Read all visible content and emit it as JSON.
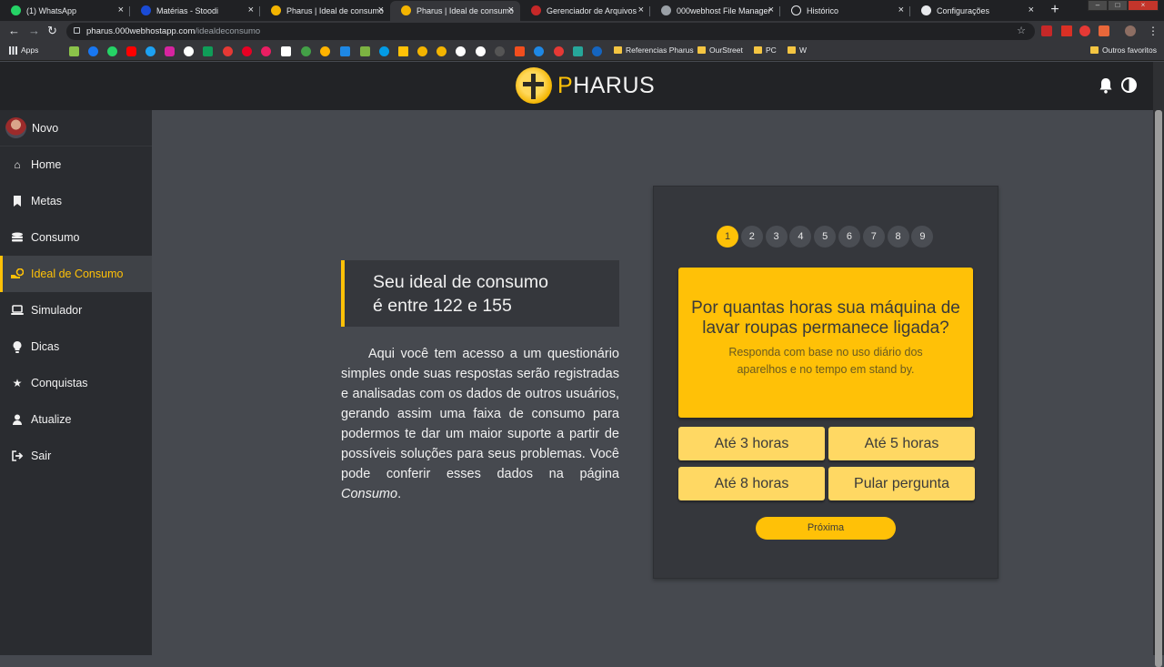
{
  "browser": {
    "tabs": [
      {
        "title": "(1) WhatsApp",
        "color": "#25d366"
      },
      {
        "title": "Matérias - Stoodi",
        "color": "#1a4bd6"
      },
      {
        "title": "Pharus | Ideal de consumo",
        "color": "#f3b400"
      },
      {
        "title": "Pharus | Ideal de consumo",
        "color": "#f3b400",
        "active": true
      },
      {
        "title": "Gerenciador de Arquivos",
        "color": "#c62828"
      },
      {
        "title": "000webhost File Manager",
        "color": "#9aa0a6"
      },
      {
        "title": "Histórico",
        "color": "#e8eaed"
      },
      {
        "title": "Configurações",
        "color": "#e8eaed"
      }
    ],
    "url_host": "pharus.000webhostapp.com",
    "url_path": "/idealdeconsumo",
    "bookmarks": {
      "apps": "Apps",
      "folders": [
        "Referencias Pharus",
        "OurStreet",
        "PC",
        "W"
      ],
      "others": "Outros favoritos"
    }
  },
  "header": {
    "logo_initial": "P",
    "logo_rest": "HARUS"
  },
  "sidebar": {
    "user": "Novo",
    "items": [
      {
        "label": "Home",
        "icon": "home-icon"
      },
      {
        "label": "Metas",
        "icon": "bookmark-icon"
      },
      {
        "label": "Consumo",
        "icon": "coins-icon"
      },
      {
        "label": "Ideal de Consumo",
        "icon": "hand-coins-icon",
        "active": true
      },
      {
        "label": "Simulador",
        "icon": "laptop-icon"
      },
      {
        "label": "Dicas",
        "icon": "lightbulb-icon"
      },
      {
        "label": "Conquistas",
        "icon": "star-icon"
      },
      {
        "label": "Atualize",
        "icon": "user-edit-icon"
      },
      {
        "label": "Sair",
        "icon": "sign-out-icon"
      }
    ]
  },
  "main": {
    "range_line1": "Seu ideal de consumo",
    "range_line2": "é entre 122 e 155",
    "description": "Aqui você tem acesso a um questionário simples onde suas respostas serão registradas e analisadas com os dados de outros usuários, gerando assim uma faixa de consumo para podermos te dar um maior suporte a partir de possíveis soluções para seus problemas. Você pode conferir esses dados na página ",
    "description_em": "Consumo",
    "description_end": "."
  },
  "quiz": {
    "steps": [
      "1",
      "2",
      "3",
      "4",
      "5",
      "6",
      "7",
      "8",
      "9"
    ],
    "current_step": 1,
    "question": "Por quantas horas sua máquina de lavar roupas permanece ligada?",
    "subtitle": "Responda com base no uso diário dos aparelhos e no tempo em stand by.",
    "answers": [
      "Até 3 horas",
      "Até 5 horas",
      "Até 8 horas",
      "Pular pergunta"
    ],
    "next_label": "Próxima"
  },
  "colors": {
    "accent": "#ffc107",
    "header_bg": "#222326",
    "sidebar_bg": "#2a2c30",
    "main_bg": "#46494f"
  }
}
